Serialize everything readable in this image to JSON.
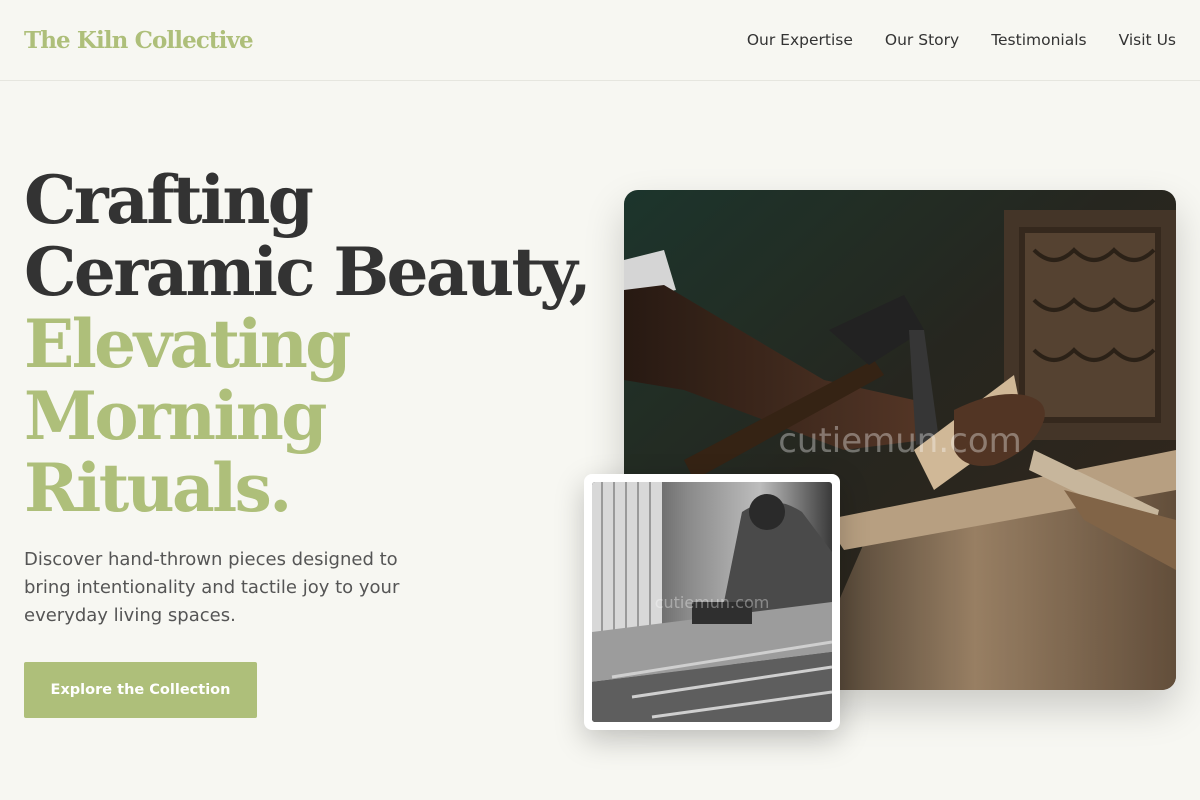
{
  "header": {
    "brand": "The Kiln Collective",
    "nav": [
      "Our Expertise",
      "Our Story",
      "Testimonials",
      "Visit Us"
    ]
  },
  "hero": {
    "headline_dark": [
      "Crafting",
      "Ceramic Beauty,"
    ],
    "headline_accent": [
      "Elevating",
      "Morning",
      "Rituals."
    ],
    "subtitle": "Discover hand-thrown pieces designed to bring intentionality and tactile joy to your everyday living spaces.",
    "cta_label": "Explore the Collection"
  },
  "images": {
    "main_watermark": "cutiemun.com",
    "small_watermark": "cutiemun.com"
  },
  "colors": {
    "accent": "#aebf7a",
    "text_dark": "#333333",
    "text_muted": "#555555",
    "background": "#f7f7f2"
  }
}
